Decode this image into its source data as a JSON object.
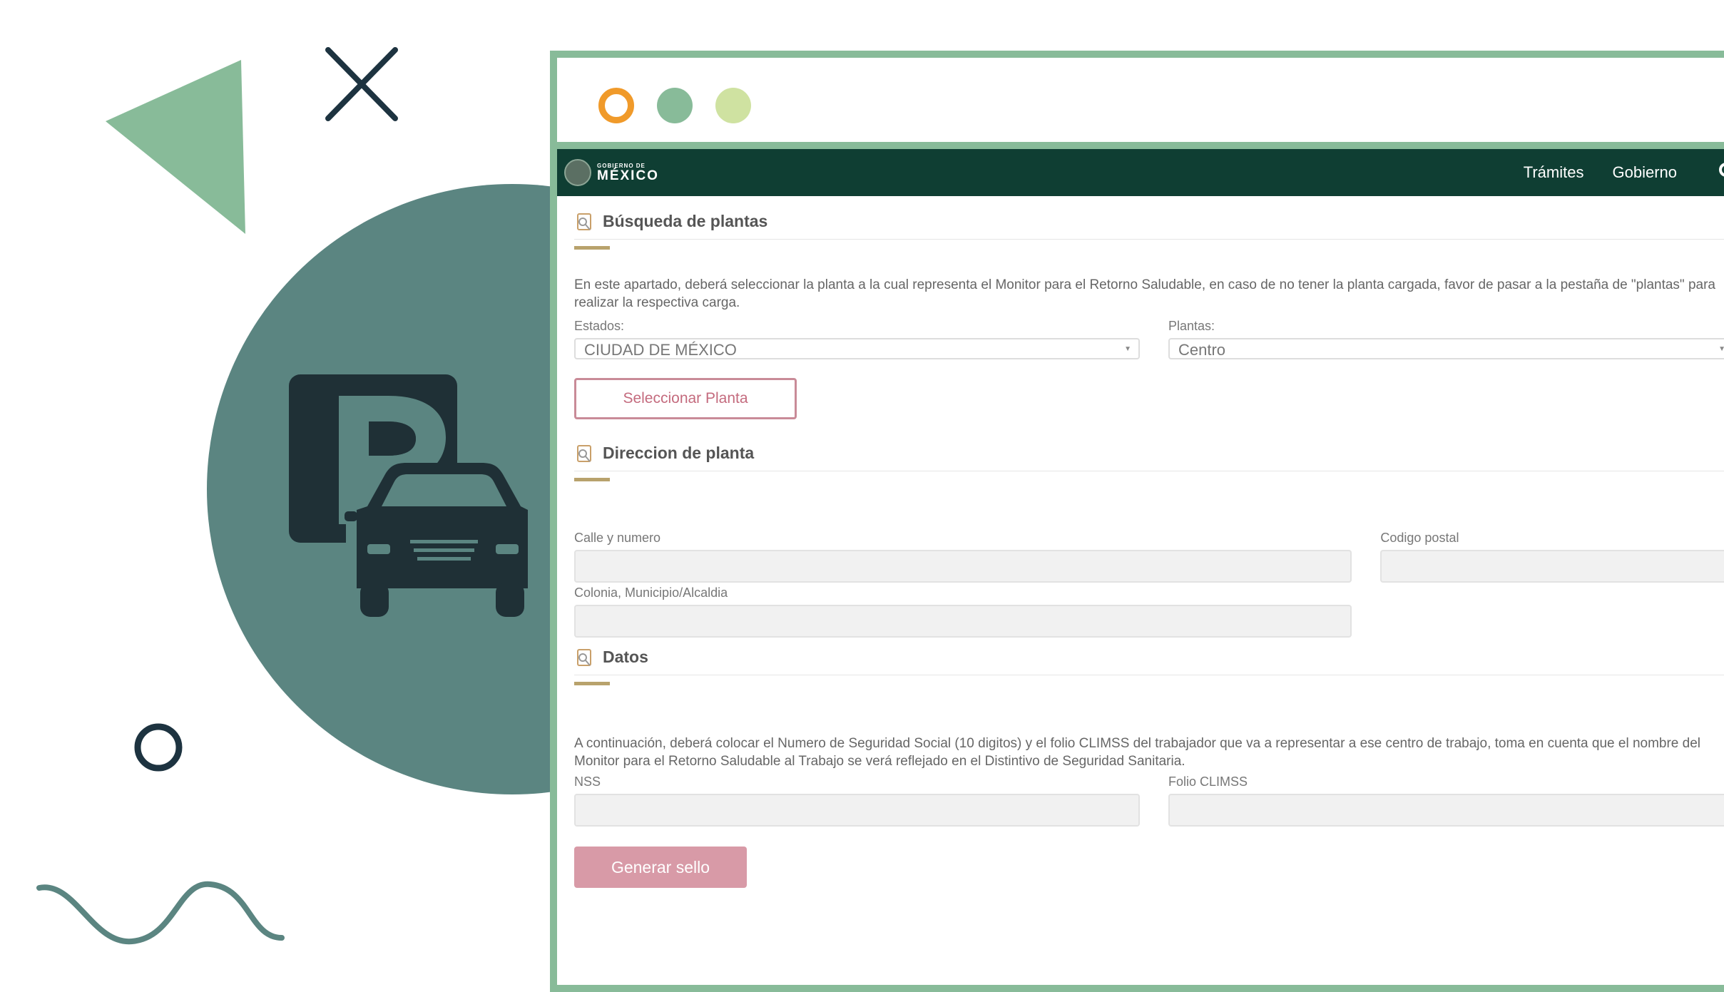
{
  "colors": {
    "teal": "#5b8581",
    "green_triangle": "#88bb99",
    "navy": "#1d3340",
    "parking_dark": "#1f3036",
    "green_border": "#88bb99",
    "orange": "#f09a2a",
    "green_dot": "#88bb99",
    "lime_dot": "#cfe2a1",
    "navbar": "#0f3e33",
    "accent": "#b8a26c",
    "pink_border": "#c98b98",
    "pink_text": "#c46b7e",
    "pink_fill": "#d89aa7"
  },
  "icons": {
    "decor": [
      "triangle-shape",
      "x-mark-icon",
      "ring-icon",
      "wave-line",
      "parking-car-icon"
    ],
    "nav": [
      "search-icon"
    ],
    "sections": [
      "form-icon"
    ]
  },
  "navbar": {
    "logo_small": "GOBIERNO DE",
    "logo_big": "MÉXICO",
    "links": [
      "Trámites",
      "Gobierno"
    ]
  },
  "search_section": {
    "title": "Búsqueda de plantas",
    "description": "En este apartado, deberá seleccionar la planta a la cual representa el Monitor para el Retorno Saludable, en caso de no tener la planta cargada, favor de pasar a la pestaña de \"plantas\" para realizar la respectiva carga.",
    "estados_label": "Estados:",
    "estados_value": "CIUDAD DE MÉXICO",
    "plantas_label": "Plantas:",
    "plantas_value": "Centro",
    "select_button": "Seleccionar Planta"
  },
  "address_section": {
    "title": "Direccion de planta",
    "street_label": "Calle y numero",
    "zip_label": "Codigo postal",
    "colony_label": "Colonia, Municipio/Alcaldia"
  },
  "data_section": {
    "title": "Datos",
    "description": "A continuación, deberá colocar el Numero de Seguridad Social (10 digitos) y el folio CLIMSS del trabajador que va a representar a ese centro de trabajo, toma en cuenta que el nombre del Monitor para el Retorno Saludable al Trabajo se verá reflejado en el Distintivo de Seguridad Sanitaria.",
    "nss_label": "NSS",
    "folio_label": "Folio CLIMSS",
    "generate_button": "Generar sello"
  }
}
